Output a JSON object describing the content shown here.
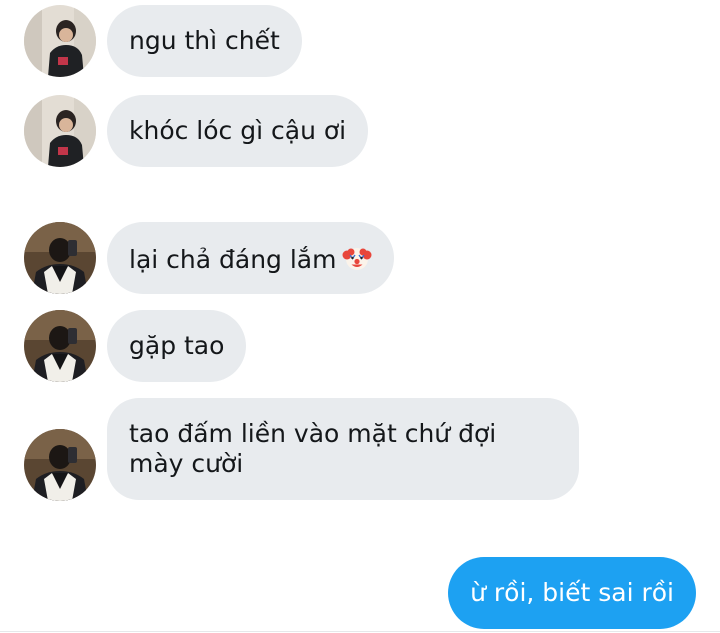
{
  "conversation": {
    "messages": [
      {
        "sender": "user_a",
        "text": "ngu thì chết"
      },
      {
        "sender": "user_a",
        "text": "khóc lóc gì cậu ơi"
      },
      {
        "sender": "user_b",
        "text": "lại chả đáng lắm",
        "emoji": "clown-face-icon"
      },
      {
        "sender": "user_b",
        "text": "gặp tao"
      },
      {
        "sender": "user_b",
        "text": "tao đấm liền vào mặt chứ đợi mày cười"
      },
      {
        "sender": "me",
        "text": "ừ rồi, biết sai rồi"
      }
    ]
  },
  "colors": {
    "incoming_bubble": "#e8ebee",
    "outgoing_bubble": "#1da1f2",
    "incoming_text": "#14171a",
    "outgoing_text": "#ffffff"
  }
}
